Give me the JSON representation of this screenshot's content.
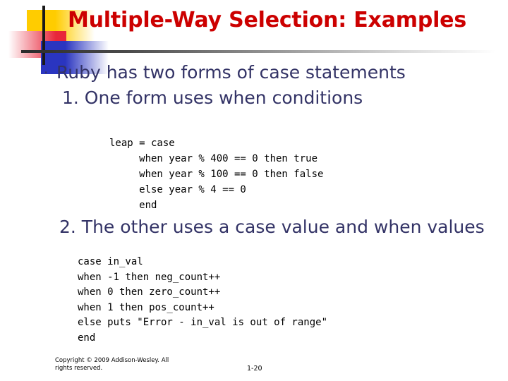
{
  "slide": {
    "title": "Multiple-Way Selection: Examples",
    "title_color": "#CC0000",
    "body_color": "#333366",
    "background": "#ffffff"
  },
  "logo": {
    "yellow": "#FFCC00",
    "red": "#E8263A",
    "blue": "#2A35C0",
    "line": "#1a1a1a"
  },
  "body": {
    "bullet_marker": "·",
    "bullet1": "Ruby has two forms of case statements",
    "sub1": "1. One form uses when conditions",
    "sub2": "2. The other uses a case value and when values"
  },
  "code_blocks": [
    {
      "name": "leap-year-case",
      "lines": [
        "leap = case",
        "     when year % 400 == 0 then true",
        "     when year % 100 == 0 then false",
        "     else year % 4 == 0",
        "     end"
      ]
    },
    {
      "name": "in-val-case",
      "lines": [
        "case in_val",
        "when -1 then neg_count++",
        "when 0 then zero_count++",
        "when 1 then pos_count++",
        "else puts \"Error - in_val is out of range\"",
        "end"
      ]
    }
  ],
  "footer": {
    "copyright": "Copyright © 2009 Addison-Wesley. All rights reserved.",
    "page_number": "1-20"
  }
}
